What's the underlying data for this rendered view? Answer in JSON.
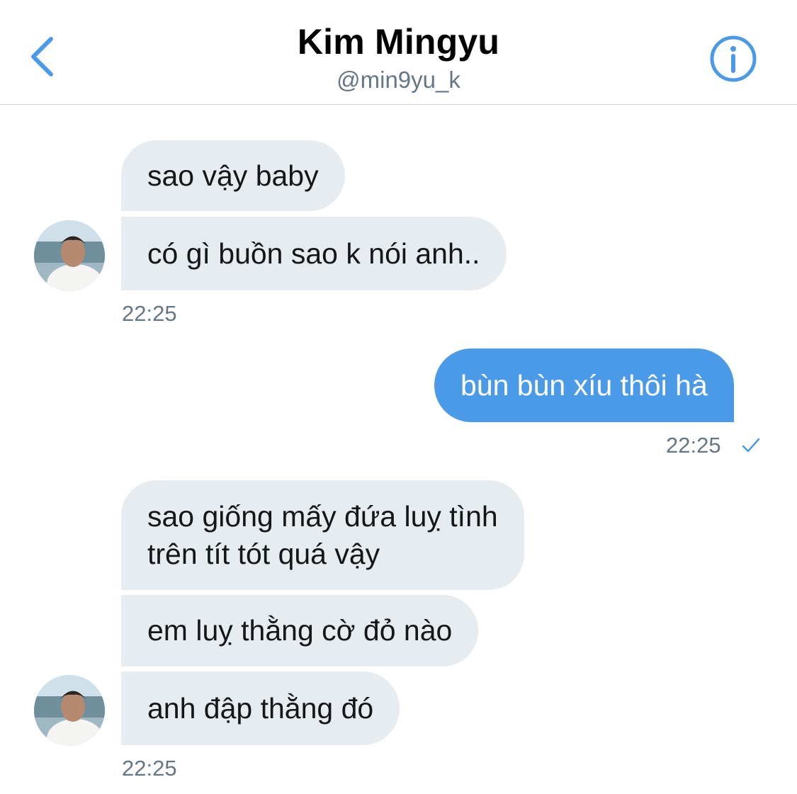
{
  "header": {
    "name": "Kim Mingyu",
    "handle": "@min9yu_k",
    "back_icon": "chevron-left-icon",
    "info_icon": "info-icon",
    "accent_color": "#4b9ae8"
  },
  "messages": [
    {
      "direction": "incoming",
      "text": "sao vậy baby"
    },
    {
      "direction": "incoming",
      "text": "có gì buồn sao k nói anh.."
    },
    {
      "direction": "outgoing",
      "text": "bùn bùn xíu thôi hà"
    },
    {
      "direction": "incoming",
      "text_lines": [
        "sao giống mấy đứa luỵ tình",
        "trên tít tót quá vậy"
      ]
    },
    {
      "direction": "incoming",
      "text": "em luỵ thằng cờ đỏ nào"
    },
    {
      "direction": "incoming",
      "text": "anh đập thằng đó"
    }
  ],
  "timestamps": [
    "22:25",
    "22:25",
    "22:25"
  ],
  "read_receipt_icon": "checkmark-icon",
  "colors": {
    "incoming_bubble": "#e6ecf0",
    "outgoing_bubble": "#4b9ae8",
    "secondary_text": "#657786"
  }
}
